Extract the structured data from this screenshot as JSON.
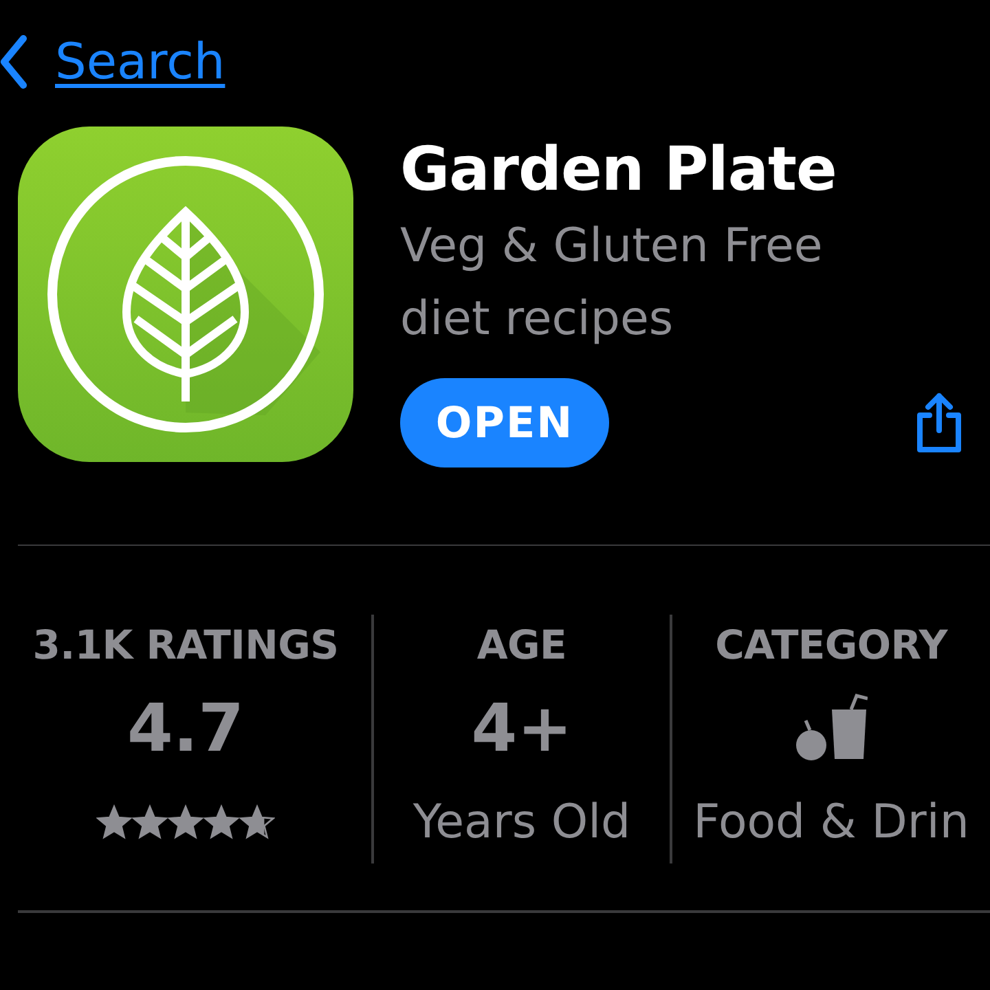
{
  "nav": {
    "back_label": "Search"
  },
  "app": {
    "name": "Garden Plate",
    "subtitle": "Veg & Gluten Free diet recipes",
    "action": "OPEN"
  },
  "stats": [
    {
      "kind": "rating",
      "header": "3.1K RATINGS",
      "value": "4.7",
      "stars": 4.7
    },
    {
      "kind": "text",
      "header": "AGE",
      "value": "4+",
      "caption": "Years Old"
    },
    {
      "kind": "category",
      "header": "CATEGORY",
      "caption": "Food & Drin"
    }
  ]
}
